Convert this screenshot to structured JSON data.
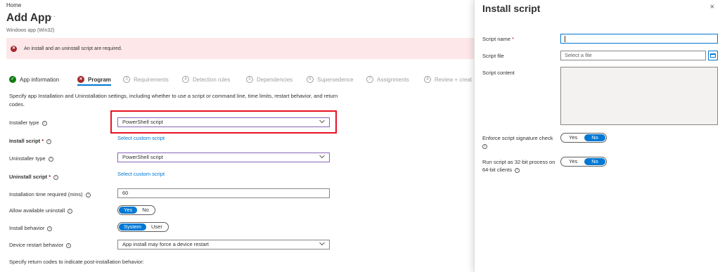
{
  "header": {
    "breadcrumb": "Home",
    "title": "Add App",
    "more": "···",
    "subtitle": "Windows app (Win32)"
  },
  "error_banner": {
    "icon": "error-icon",
    "text": "An install and an uninstall script are required."
  },
  "steps": [
    {
      "number": "✓",
      "label": "App information",
      "state": "done"
    },
    {
      "number": "✕",
      "label": "Program",
      "state": "error"
    },
    {
      "number": "3",
      "label": "Requirements",
      "state": "pending"
    },
    {
      "number": "4",
      "label": "Detection rules",
      "state": "pending"
    },
    {
      "number": "5",
      "label": "Dependencies",
      "state": "pending"
    },
    {
      "number": "6",
      "label": "Supersedence",
      "state": "pending"
    },
    {
      "number": "7",
      "label": "Assignments",
      "state": "pending"
    },
    {
      "number": "8",
      "label": "Review + creat",
      "state": "pending"
    }
  ],
  "program": {
    "description": "Specify app Installation and Uninstallation settings, including whether to use a script or command line, time limits, restart behavior, and return codes.",
    "installer_type_label": "Installer type",
    "installer_type_value": "PowerShell script",
    "install_script_label": "Install script",
    "install_script_link": "Select custom script",
    "uninstaller_type_label": "Uninstaller type",
    "uninstaller_type_value": "PowerShell script",
    "uninstall_script_label": "Uninstall script",
    "uninstall_script_link": "Select custom script",
    "install_time_label": "Installation time required (mins)",
    "install_time_value": "60",
    "allow_uninstall_label": "Allow available uninstall",
    "allow_uninstall_yes": "Yes",
    "allow_uninstall_no": "No",
    "install_behavior_label": "Install behavior",
    "install_behavior_system": "System",
    "install_behavior_user": "User",
    "restart_label": "Device restart behavior",
    "restart_value": "App install may force a device restart",
    "return_codes_text": "Specify return codes to indicate post-installation behavior:",
    "required_marker": "*",
    "info_glyph": "i"
  },
  "panel": {
    "title": "Install script",
    "close": "×",
    "script_name_label": "Script name",
    "script_name_value": "",
    "script_file_label": "Script file",
    "script_file_placeholder": "Select a file",
    "script_content_label": "Script content",
    "enforce_label": "Enforce script signature check",
    "enforce_yes": "Yes",
    "enforce_no": "No",
    "run32_label": "Run script as 32-bit process on 64-bit clients",
    "run32_yes": "Yes",
    "run32_no": "No"
  },
  "colors": {
    "accent": "#0078d4",
    "error": "#a4262c",
    "success": "#107c10",
    "highlight": "#e81123"
  }
}
